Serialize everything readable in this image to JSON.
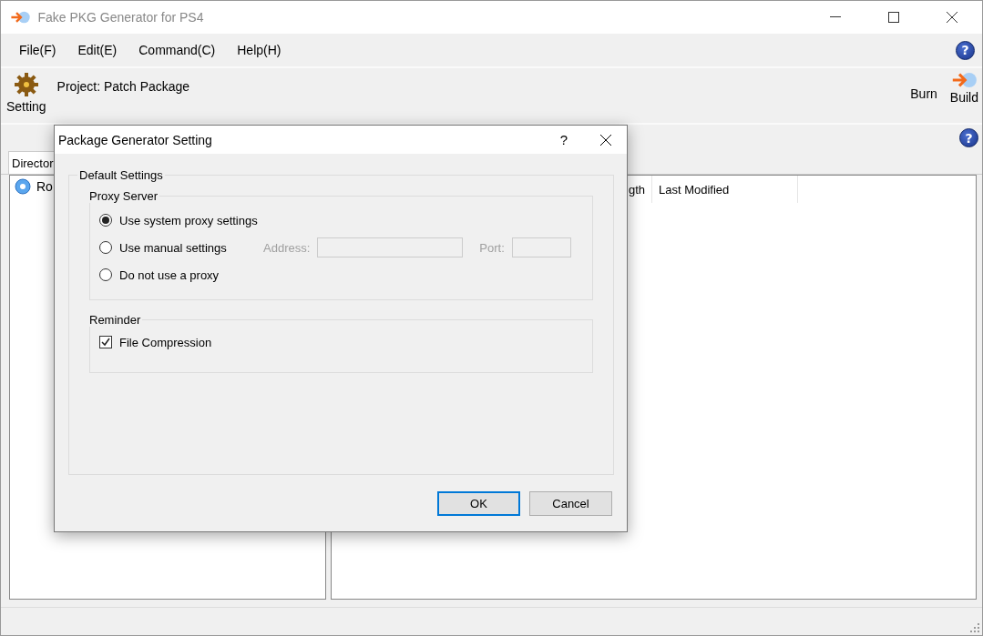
{
  "window": {
    "title": "Fake PKG Generator for PS4"
  },
  "menu": [
    "File(F)",
    "Edit(E)",
    "Command(C)",
    "Help(H)"
  ],
  "menu_help": "?",
  "panel_help": "?",
  "toolbar": {
    "setting": "Setting",
    "project": "Project: Patch Package",
    "burn": "Burn",
    "build": "Build"
  },
  "left_panel": {
    "tab": "Director",
    "tree": [
      {
        "label": "Ro"
      }
    ]
  },
  "file_list": {
    "columns": [
      "gth",
      "Last Modified"
    ]
  },
  "dialog": {
    "title": "Package Generator Setting",
    "help": "?",
    "group": "Default Settings",
    "proxy": {
      "title": "Proxy Server",
      "options": [
        {
          "label": "Use system proxy settings",
          "selected": true
        },
        {
          "label": "Use manual settings",
          "selected": false
        },
        {
          "label": "Do not use a proxy",
          "selected": false
        }
      ],
      "address": {
        "label": "Address:",
        "disabled": true
      },
      "port": {
        "label": "Port:",
        "disabled": true
      }
    },
    "reminder": {
      "title": "Reminder",
      "checkbox": {
        "label": "File Compression",
        "checked": true
      }
    },
    "buttons": [
      {
        "label": "OK",
        "default": true
      },
      {
        "label": "Cancel",
        "default": false
      }
    ]
  }
}
